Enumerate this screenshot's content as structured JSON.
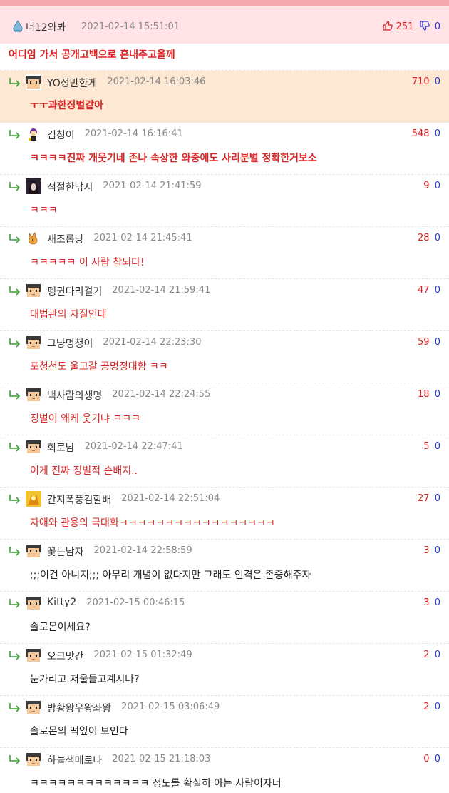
{
  "main_comment": {
    "nickname": "너12와봐",
    "date": "2021-02-14 15:51:01",
    "upvotes": "251",
    "downvotes": "0",
    "text": "어디임 가서 공개고백으로 혼내주고올께"
  },
  "replies": [
    {
      "nickname": "YO정만한게",
      "date": "2021-02-14 16:03:46",
      "upvotes": "710",
      "downvotes": "0",
      "text": "ㅜㅜ과한징벌같아",
      "avatar": "pixel-face"
    },
    {
      "nickname": "김청이",
      "date": "2021-02-14 16:16:41",
      "upvotes": "548",
      "downvotes": "0",
      "text": "ㅋㅋㅋㅋ진짜 개웃기네 존나 속상한 와중에도 사리분별 정확한거보소",
      "avatar": "pixel-character"
    },
    {
      "nickname": "적절한낚시",
      "date": "2021-02-14 21:41:59",
      "upvotes": "9",
      "downvotes": "0",
      "text": "ㅋㅋㅋ",
      "avatar": "photo-portrait"
    },
    {
      "nickname": "새조롭냥",
      "date": "2021-02-14 21:45:41",
      "upvotes": "28",
      "downvotes": "0",
      "text": "ㅋㅋㅋㅋㅋ 이 사람 참되다!",
      "avatar": "cartoon-animal"
    },
    {
      "nickname": "펭귄다리걸기",
      "date": "2021-02-14 21:59:41",
      "upvotes": "47",
      "downvotes": "0",
      "text": "대법관의 자질인데",
      "avatar": "pixel-face"
    },
    {
      "nickname": "그냥멍청이",
      "date": "2021-02-14 22:23:30",
      "upvotes": "59",
      "downvotes": "0",
      "text": "포청천도 울고갈 공명정대함 ㅋㅋ",
      "avatar": "pixel-face"
    },
    {
      "nickname": "백사람의생명",
      "date": "2021-02-14 22:24:55",
      "upvotes": "18",
      "downvotes": "0",
      "text": "징벌이 왜케 웃기냐 ㅋㅋㅋ",
      "avatar": "pixel-face"
    },
    {
      "nickname": "회로남",
      "date": "2021-02-14 22:47:41",
      "upvotes": "5",
      "downvotes": "0",
      "text": "이게 진짜 징벌적 손배지..",
      "avatar": "pixel-face"
    },
    {
      "nickname": "간지폭풍김할배",
      "date": "2021-02-14 22:51:04",
      "upvotes": "27",
      "downvotes": "0",
      "text": "자애와 관용의 극대화ㅋㅋㅋㅋㅋㅋㅋㅋㅋㅋㅋㅋㅋㅋㅋㅋㅋ",
      "avatar": "gold-image"
    },
    {
      "nickname": "꽃는남자",
      "date": "2021-02-14 22:58:59",
      "upvotes": "3",
      "downvotes": "0",
      "text": ";;;이건 아니지;;; 아무리 개념이 없다지만 그래도 인격은 존중해주자",
      "avatar": "pixel-face"
    },
    {
      "nickname": "Kitty2",
      "date": "2021-02-15 00:46:15",
      "upvotes": "3",
      "downvotes": "0",
      "text": "솔로몬이세요?",
      "avatar": "pixel-face"
    },
    {
      "nickname": "오크맛간",
      "date": "2021-02-15 01:32:49",
      "upvotes": "2",
      "downvotes": "0",
      "text": "눈가리고 저울들고계시나?",
      "avatar": "pixel-face"
    },
    {
      "nickname": "방황왕우왕좌왕",
      "date": "2021-02-15 03:06:49",
      "upvotes": "2",
      "downvotes": "0",
      "text": "솔로몬의 떡잎이 보인다",
      "avatar": "pixel-face"
    },
    {
      "nickname": "하늘색메로나",
      "date": "2021-02-15 21:18:03",
      "upvotes": "0",
      "downvotes": "0",
      "text": "ㅋㅋㅋㅋㅋㅋㅋㅋㅋㅋㅋㅋㅋ 정도를 확실히 아는 사람이자너",
      "avatar": "pixel-face"
    }
  ],
  "colors": {
    "header_bar": "#f5a9ae",
    "main_bg": "#ffe3e6",
    "highlight_bg": "#fde8d3",
    "red_text": "#d92626",
    "upvote": "#e02020",
    "downvote": "#2336d8",
    "reply_arrow": "#3aa335"
  }
}
